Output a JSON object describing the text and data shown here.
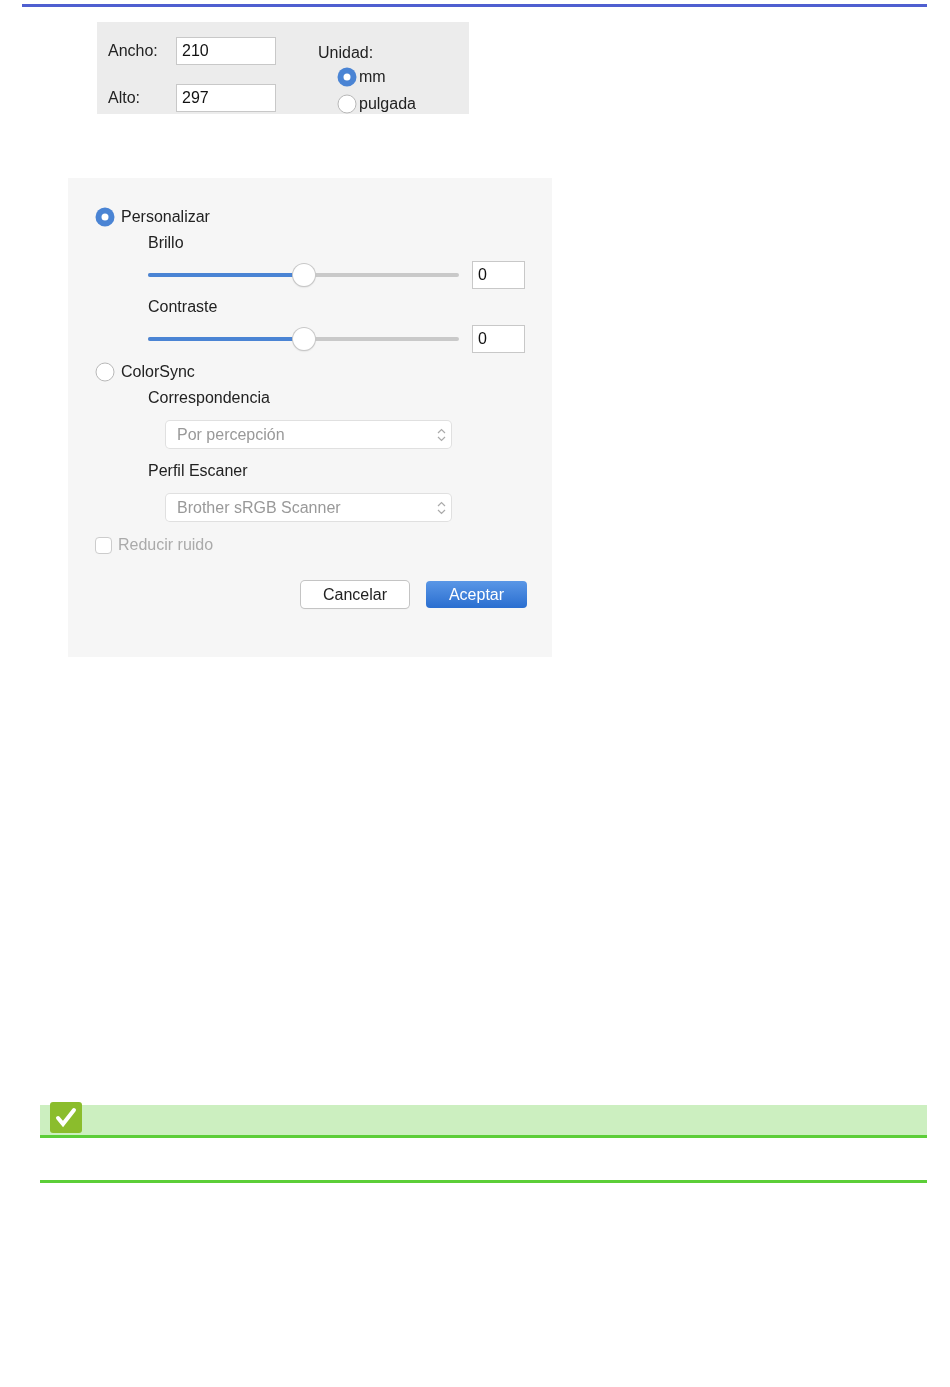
{
  "size_panel": {
    "fields": [
      {
        "label": "Ancho:",
        "value": "210"
      },
      {
        "label": "Alto:",
        "value": "297"
      }
    ],
    "unit": {
      "label": "Unidad:",
      "options": [
        {
          "label": "mm",
          "selected": true
        },
        {
          "label": "pulgada",
          "selected": false
        }
      ]
    }
  },
  "color_panel": {
    "modes": [
      {
        "label": "Personalizar",
        "selected": true
      },
      {
        "label": "ColorSync",
        "selected": false
      }
    ],
    "sliders": [
      {
        "label": "Brillo",
        "level": 0.5,
        "value": "0"
      },
      {
        "label": "Contraste",
        "level": 0.5,
        "value": "0"
      }
    ],
    "dropdowns": [
      {
        "label": "Correspondencia",
        "value": "Por percepción",
        "disabled": true
      },
      {
        "label": "Perfil Escaner",
        "value": "Brother sRGB Scanner",
        "disabled": true
      }
    ],
    "noise": {
      "label": "Reducir ruido",
      "checked": false,
      "disabled": true
    },
    "buttons": [
      {
        "label": "Cancelar",
        "kind": "secondary"
      },
      {
        "label": "Aceptar",
        "kind": "primary"
      }
    ]
  },
  "note": {
    "kind": "check"
  }
}
